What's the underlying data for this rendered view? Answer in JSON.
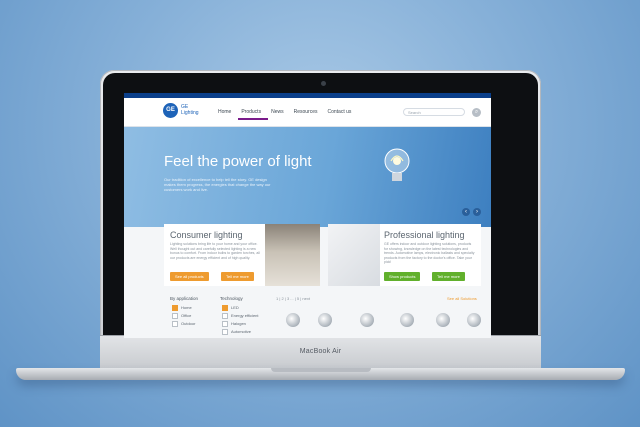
{
  "device": {
    "brand_label": "MacBook Air"
  },
  "site": {
    "logo_mark": "GE",
    "logo_text": "GE Lighting",
    "nav": [
      "Home",
      "Products",
      "News",
      "Resources",
      "Contact us"
    ],
    "search": {
      "placeholder": "Search",
      "icon": "search-icon"
    },
    "accent": "#7a1b8a"
  },
  "hero": {
    "title": "Feel the power of light",
    "text": "Our tradition of excellence to help tell the story. GE design makes them progress, the energies that change the way our customers work and live.",
    "prev_label": "‹",
    "next_label": "›"
  },
  "consumer": {
    "title": "Consumer lighting",
    "text": "Lighting solutions bring life to your home and your office. Well thought out and carefully selected lighting is a new bonus to comfort. From indoor bulbs to garden torches, all our products are energy efficient and of high quality.",
    "btn_products": "See all products",
    "btn_learn": "Tell me more",
    "color": "#ee9b2f"
  },
  "professional": {
    "title": "Professional lighting",
    "text": "GE offers indoor and outdoor lighting solutions, products for showing, knowledge on the latest technologies and trends. Automotive lamps, electronic ballasts and specialty products from the factory to the doctor's office. Take your pick!",
    "btn_products": "Show products",
    "btn_learn": "Tell me more",
    "color": "#61b02c"
  },
  "filters": {
    "application": {
      "label": "By application",
      "options": [
        {
          "label": "Home",
          "checked": true
        },
        {
          "label": "Office",
          "checked": false
        },
        {
          "label": "Outdoor",
          "checked": false
        }
      ]
    },
    "technology": {
      "label": "Technology",
      "options": [
        {
          "label": "LED",
          "checked": true
        },
        {
          "label": "Energy efficient",
          "checked": false
        },
        {
          "label": "Halogen",
          "checked": false
        },
        {
          "label": "Automotive",
          "checked": false
        }
      ]
    },
    "pager": "1 | 2 | 3 ... | 5 | next",
    "see_all": "See all Solutions"
  }
}
